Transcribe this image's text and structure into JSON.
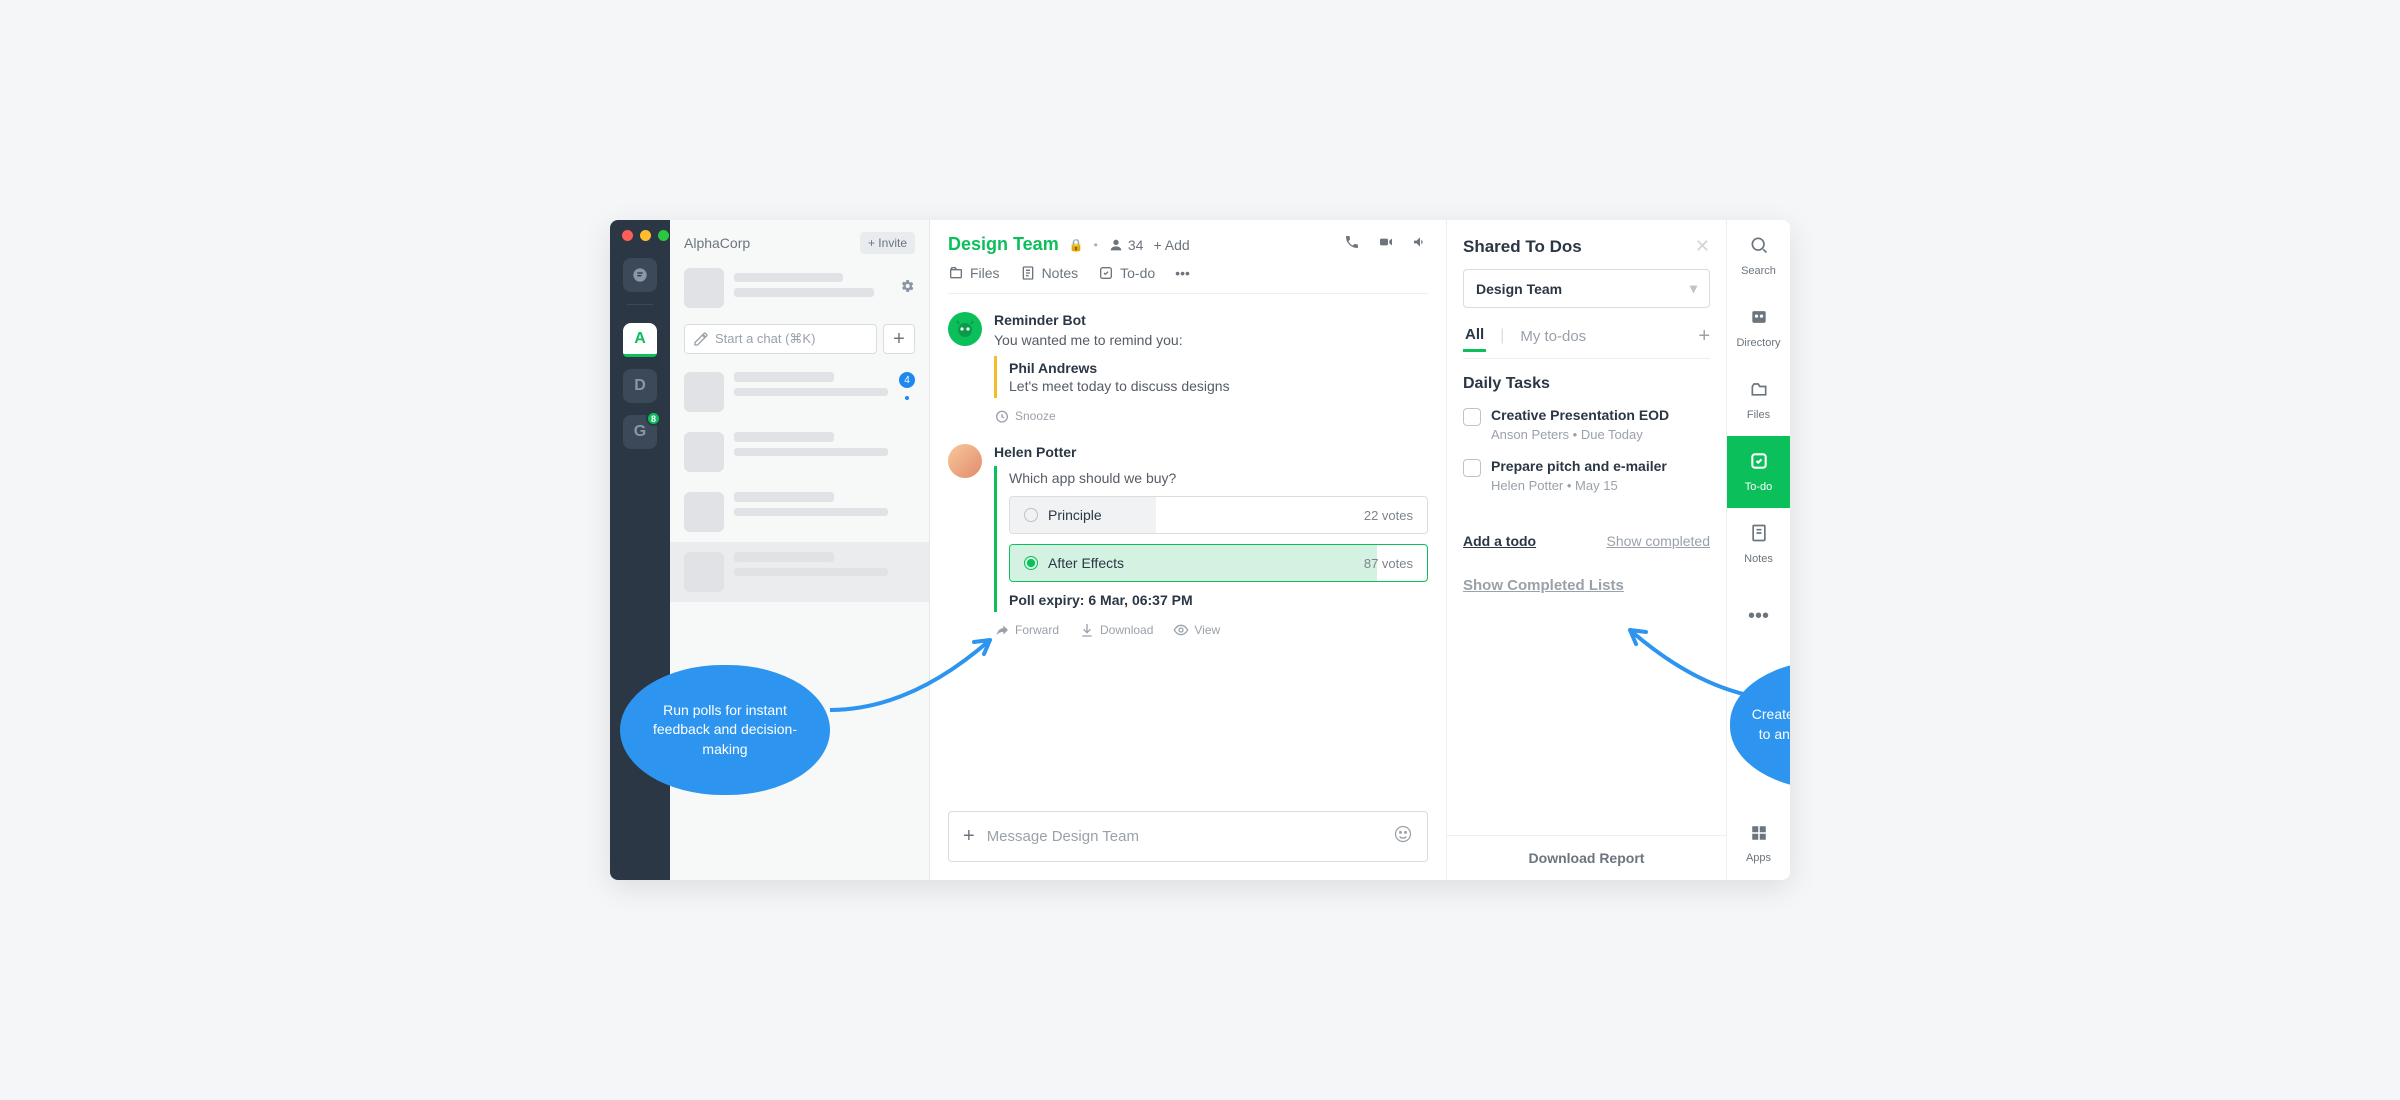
{
  "workspace_name": "AlphaCorp",
  "invite_label": "+ Invite",
  "search_placeholder": "Start a chat (⌘K)",
  "rail": {
    "workspaces": [
      {
        "letter": "A",
        "active": true
      },
      {
        "letter": "D",
        "active": false
      },
      {
        "letter": "G",
        "active": false,
        "badge": "8"
      }
    ]
  },
  "sidebar": {
    "unread_badge": "4"
  },
  "channel": {
    "name": "Design Team",
    "member_count": "34",
    "add_label": "+ Add",
    "tabs": {
      "files": "Files",
      "notes": "Notes",
      "todo": "To-do"
    }
  },
  "messages": {
    "bot": {
      "name": "Reminder Bot",
      "text": "You wanted me to remind you:",
      "quote_name": "Phil Andrews",
      "quote_text": "Let's meet today to discuss designs",
      "snooze": "Snooze"
    },
    "helen": {
      "name": "Helen Potter",
      "poll_q": "Which app should we buy?",
      "opts": [
        {
          "label": "Principle",
          "votes": "22 votes",
          "pct": 35,
          "selected": false
        },
        {
          "label": "After Effects",
          "votes": "87 votes",
          "pct": 88,
          "selected": true
        }
      ],
      "expiry": "Poll expiry: 6 Mar, 06:37 PM",
      "actions": {
        "forward": "Forward",
        "download": "Download",
        "view": "View"
      }
    }
  },
  "composer_placeholder": "Message Design Team",
  "todos_panel": {
    "title": "Shared To Dos",
    "selector": "Design Team",
    "tabs": {
      "all": "All",
      "mine": "My to-dos"
    },
    "section_title": "Daily Tasks",
    "items": [
      {
        "title": "Creative Presentation EOD",
        "meta": "Anson Peters  •  Due Today"
      },
      {
        "title": "Prepare pitch and e-mailer",
        "meta": "Helen Potter  •  May 15"
      }
    ],
    "add_link": "Add a todo",
    "show_completed": "Show completed",
    "completed_lists": "Show Completed Lists",
    "download_report": "Download Report"
  },
  "right_rail": {
    "search": "Search",
    "directory": "Directory",
    "files": "Files",
    "todo": "To-do",
    "notes": "Notes",
    "apps": "Apps"
  },
  "callouts": {
    "left": "Run polls for instant feedback and decision-making",
    "right": "Create and assign to-dos to anyone in your team"
  }
}
